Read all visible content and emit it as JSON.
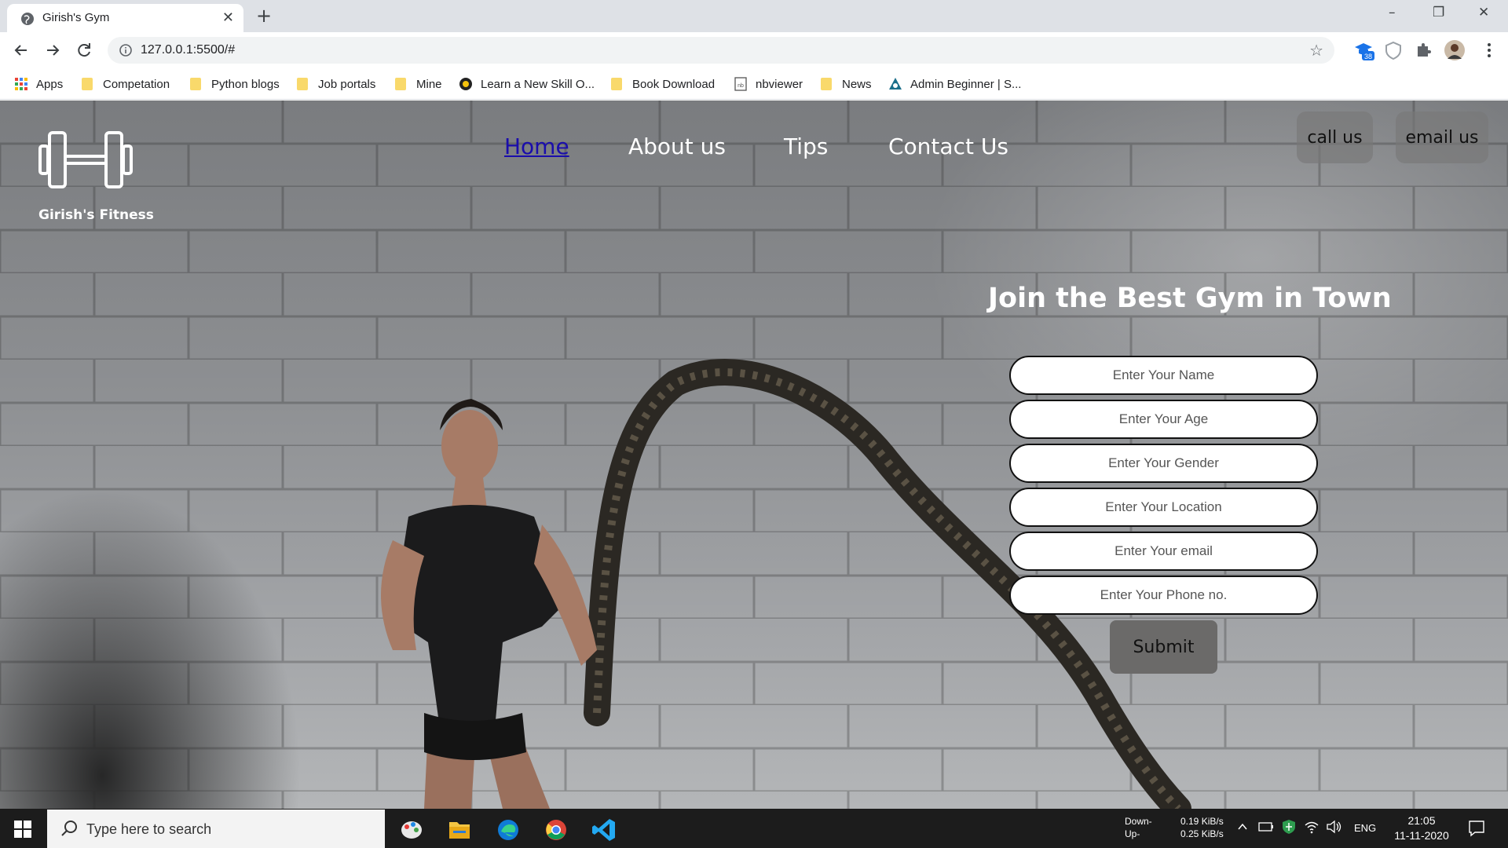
{
  "browser": {
    "tab_title": "Girish's Gym",
    "new_tab_glyph": "+",
    "close_glyph": "✕",
    "url": "127.0.0.1:5500/#",
    "window_controls": [
      "–",
      "❐",
      "✕"
    ],
    "extension_badge": "38"
  },
  "bookmarks": [
    {
      "label": "Apps",
      "icon": "apps-grid-icon"
    },
    {
      "label": "Competation",
      "icon": "folder-icon"
    },
    {
      "label": "Python blogs",
      "icon": "folder-icon"
    },
    {
      "label": "Job portals",
      "icon": "folder-icon"
    },
    {
      "label": "Mine",
      "icon": "folder-icon"
    },
    {
      "label": "Learn a New Skill O...",
      "icon": "site-icon"
    },
    {
      "label": "Book Download",
      "icon": "folder-icon"
    },
    {
      "label": "nbviewer",
      "icon": "nbviewer-icon"
    },
    {
      "label": "News",
      "icon": "folder-icon"
    },
    {
      "label": "Admin Beginner | S...",
      "icon": "site-icon"
    }
  ],
  "site": {
    "brand": "Girish's Fitness",
    "nav": [
      {
        "label": "Home",
        "active": true
      },
      {
        "label": "About us",
        "active": false
      },
      {
        "label": "Tips",
        "active": false
      },
      {
        "label": "Contact Us",
        "active": false
      }
    ],
    "call_label": "call us",
    "email_label": "email us",
    "hero_title": "Join the Best Gym in Town",
    "form": {
      "name_placeholder": "Enter Your Name",
      "age_placeholder": "Enter Your Age",
      "gender_placeholder": "Enter Your Gender",
      "location_placeholder": "Enter Your Location",
      "email_placeholder": "Enter Your email",
      "phone_placeholder": "Enter Your Phone no.",
      "submit_label": "Submit"
    }
  },
  "taskbar": {
    "search_placeholder": "Type here to search",
    "net_down_label": "Down-",
    "net_up_label": "Up-",
    "net_down": "0.19 KiB/s",
    "net_up": "0.25 KiB/s",
    "language": "ENG",
    "time": "21:05",
    "date": "11-11-2020"
  },
  "colors": {
    "active_link": "#1a0dab",
    "pill_bg": "#7a7a7a",
    "submit_bg": "#6b6a69"
  }
}
